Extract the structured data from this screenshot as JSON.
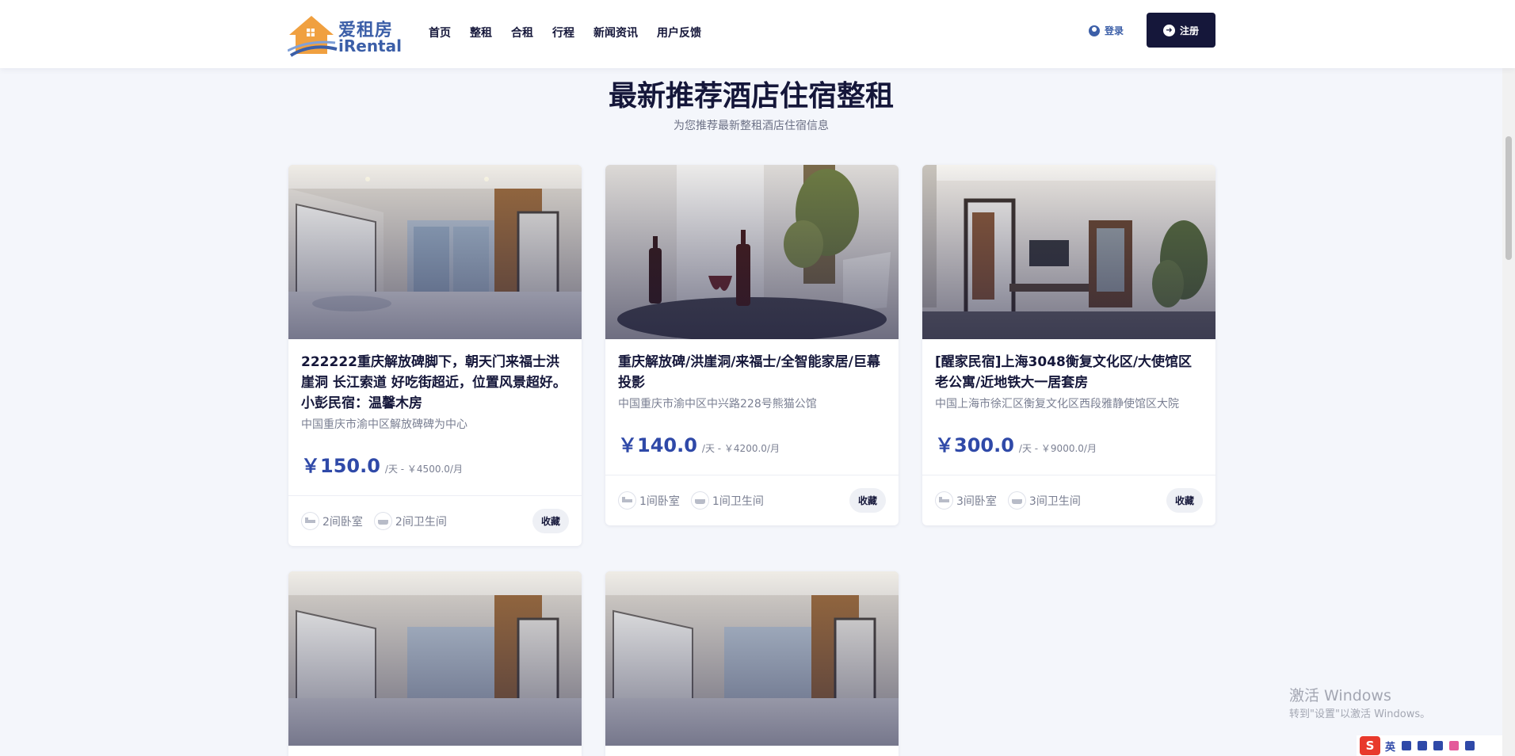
{
  "header": {
    "logo_cn": "爱租房",
    "logo_en": "iRental",
    "nav": [
      "首页",
      "整租",
      "合租",
      "行程",
      "新闻资讯",
      "用户反馈"
    ],
    "login": "登录",
    "register": "注册"
  },
  "section": {
    "title": "最新推荐酒店住宿整租",
    "subtitle": "为您推荐最新整租酒店住宿信息"
  },
  "listings": [
    {
      "title": "222222重庆解放碑脚下，朝天门来福士洪崖洞 长江索道 好吃街超近，位置风景超好。小彭民宿：温馨木房",
      "address": "中国重庆市渝中区解放碑碑为中心",
      "price": "￥150.0",
      "per": "/天 -  ￥4500.0/月",
      "bedrooms": "2间卧室",
      "bathrooms": "2间卫生间",
      "fav": "收藏"
    },
    {
      "title": "重庆解放碑/洪崖洞/来福士/全智能家居/巨幕投影",
      "address": "中国重庆市渝中区中兴路228号熊猫公馆",
      "price": "￥140.0",
      "per": "/天 -  ￥4200.0/月",
      "bedrooms": "1间卧室",
      "bathrooms": "1间卫生间",
      "fav": "收藏"
    },
    {
      "title": "[醒家民宿]上海3048衡复文化区/大使馆区老公寓/近地铁大一居套房",
      "address": "中国上海市徐汇区衡复文化区西段雅静使馆区大院",
      "price": "￥300.0",
      "per": "/天 -  ￥9000.0/月",
      "bedrooms": "3间卧室",
      "bathrooms": "3间卫生间",
      "fav": "收藏"
    }
  ],
  "watermark": {
    "line1": "激活 Windows",
    "line2": "转到\"设置\"以激活 Windows。"
  },
  "tray": {
    "ime": "S",
    "lang": "英"
  },
  "colors": {
    "navy": "#15173a",
    "accent": "#2f49a8",
    "logo_orange": "#f0a040"
  }
}
